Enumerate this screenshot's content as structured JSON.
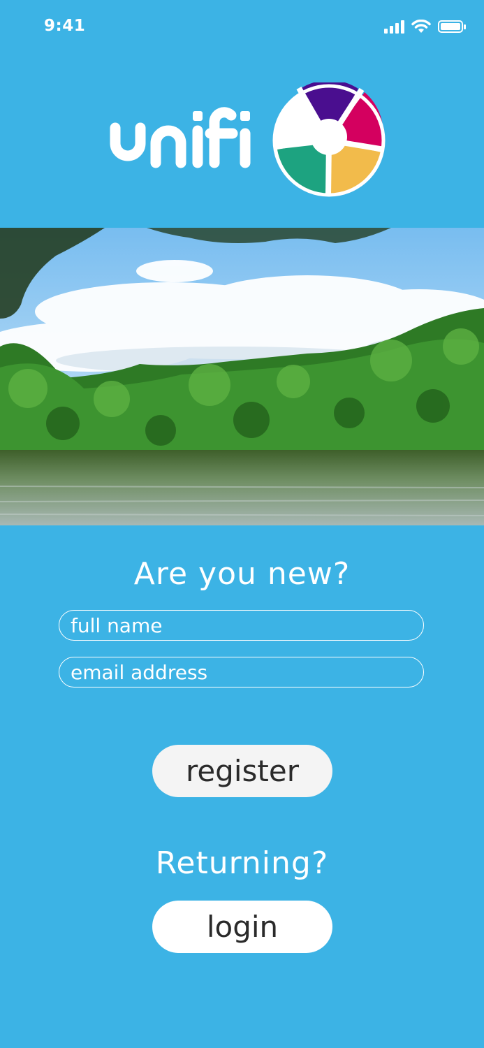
{
  "status_bar": {
    "time": "9:41",
    "icons": [
      "signal-icon",
      "wifi-icon",
      "battery-icon"
    ]
  },
  "brand": {
    "logo_text": "unifi",
    "wheel_colors": [
      "#4A0E8F",
      "#D4005F",
      "#F2BB4B",
      "#1DA380"
    ]
  },
  "hero": {
    "description_icon": "lake-landscape-photo"
  },
  "register_section": {
    "heading": "Are you new?",
    "full_name_placeholder": "full name",
    "email_placeholder": "email address",
    "register_label": "register"
  },
  "login_section": {
    "heading": "Returning?",
    "login_label": "login"
  },
  "colors": {
    "background": "#3CB3E5",
    "button_bg": "#F4F4F4",
    "button_text": "#2A2A2A"
  }
}
